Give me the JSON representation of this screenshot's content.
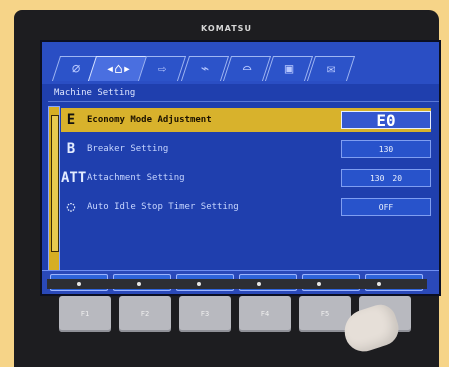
{
  "brand": "KOMATSU",
  "screen": {
    "tabs": [
      {
        "icon": "⌀",
        "active": false
      },
      {
        "icon": "◂⌂▸",
        "active": true
      },
      {
        "icon": "⇨",
        "active": false
      },
      {
        "icon": "⌁",
        "active": false
      },
      {
        "icon": "⌓",
        "active": false
      },
      {
        "icon": "▣",
        "active": false
      },
      {
        "icon": "✉",
        "active": false
      }
    ],
    "breadcrumb": "Machine Setting",
    "rows": [
      {
        "icon": "E",
        "label": "Economy Mode Adjustment",
        "value": "E0",
        "selected": true
      },
      {
        "icon": "B",
        "label": "Breaker Setting",
        "value": "130",
        "secondary": "",
        "selected": false
      },
      {
        "icon": "ATT",
        "label": "Attachment Setting",
        "value": "130",
        "secondary": "20",
        "selected": false
      },
      {
        "icon": "◌",
        "label": "Auto Idle Stop Timer Setting",
        "value": "OFF",
        "selected": false
      }
    ],
    "nav": [
      "◀",
      "▶",
      "▼",
      "▲",
      "↶",
      "✓"
    ]
  },
  "hardware": {
    "fkeys": [
      "F1",
      "F2",
      "F3",
      "F4",
      "F5",
      "F6"
    ]
  }
}
